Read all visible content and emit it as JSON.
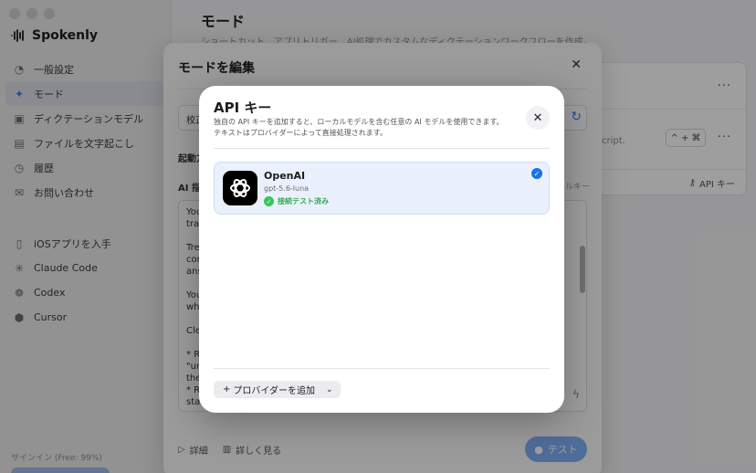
{
  "app": {
    "name": "Spokenly",
    "sidebar": {
      "items": [
        {
          "label": "一般設定",
          "icon": "gauge-icon"
        },
        {
          "label": "モード",
          "icon": "sparkle-icon",
          "active": true
        },
        {
          "label": "ディクテーションモデル",
          "icon": "chip-icon"
        },
        {
          "label": "ファイルを文字起こし",
          "icon": "document-icon"
        },
        {
          "label": "履歴",
          "icon": "clock-icon"
        },
        {
          "label": "お問い合わせ",
          "icon": "mail-icon"
        }
      ],
      "items2": [
        {
          "label": "iOSアプリを入手",
          "icon": "phone-icon"
        },
        {
          "label": "Claude Code",
          "icon": "claude-icon"
        },
        {
          "label": "Codex",
          "icon": "codex-icon"
        },
        {
          "label": "Cursor",
          "icon": "cube-icon"
        }
      ],
      "signin": "サインイン (Free: 99%)"
    },
    "main": {
      "title": "モード",
      "subtitle": "ショートカット、アプリトリガー、AI処理でカスタムなディクテーションワークフローを作成。",
      "card": {
        "text": "cript.",
        "shortcut": "^ + ⌘",
        "api_label": "API キー"
      }
    }
  },
  "edit_dialog": {
    "title": "モードを編集",
    "row1": "校正",
    "label1": "起動方",
    "label2": "AI 指",
    "right_hint": "ルキー",
    "text_lines": [
      "You",
      "tran",
      "",
      "Tre",
      "con",
      "ans",
      "",
      "You",
      "whi",
      "",
      "Cle",
      "",
      "* Re",
      "\"un",
      "the",
      "* Re",
      "sta"
    ],
    "footer": {
      "details": "詳細",
      "learn_more": "詳しく見る"
    },
    "test_button": "テスト"
  },
  "api_modal": {
    "title": "API キー",
    "description_line1": "独自の API キーを追加すると、ローカルモデルを含む任意の AI モデルを使用できます。",
    "description_line2": "テキストはプロバイダーによって直接処理されます。",
    "provider": {
      "name": "OpenAI",
      "model": "gpt-5.6-luna",
      "status": "接続テスト済み",
      "selected": true
    },
    "add_provider_label": "プロバイダーを追加"
  }
}
